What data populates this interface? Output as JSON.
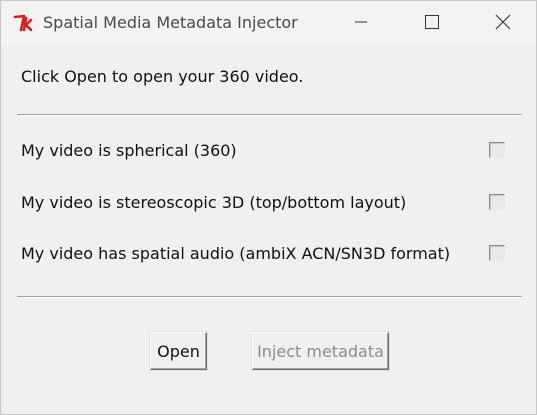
{
  "window": {
    "title": "Spatial Media Metadata Injector",
    "app_icon": "tk-icon",
    "controls": {
      "minimize": "minimize-icon",
      "maximize": "maximize-icon",
      "close": "close-icon"
    }
  },
  "main": {
    "instruction": "Click Open to open your 360 video.",
    "options": [
      {
        "label": "My video is spherical (360)",
        "checked": false,
        "enabled": false
      },
      {
        "label": "My video is stereoscopic 3D (top/bottom layout)",
        "checked": false,
        "enabled": false
      },
      {
        "label": "My video has spatial audio (ambiX ACN/SN3D format)",
        "checked": false,
        "enabled": false
      }
    ]
  },
  "buttons": {
    "open_label": "Open",
    "inject_label": "Inject metadata",
    "inject_enabled": false
  },
  "colors": {
    "background": "#f0f0f0",
    "tk_icon": "#d42020",
    "disabled_text": "#8c8c8c"
  }
}
